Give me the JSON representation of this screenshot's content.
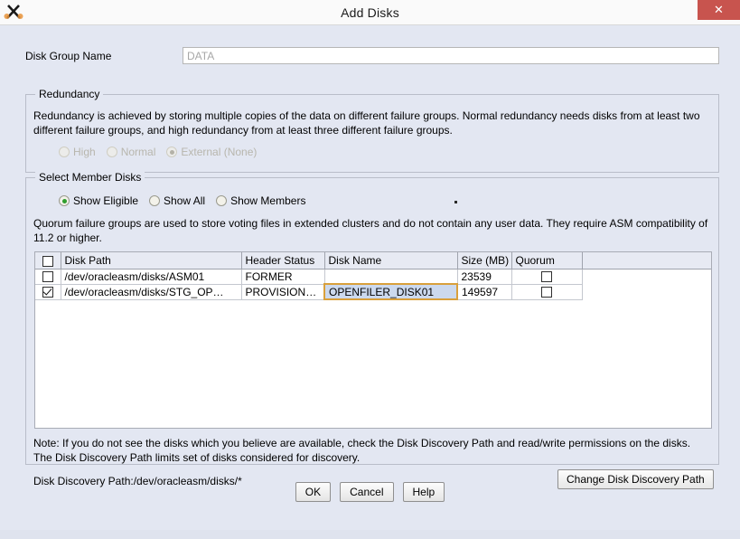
{
  "window": {
    "title": "Add Disks",
    "close_label": "✕",
    "app_icon": "x11-icon"
  },
  "disk_group": {
    "label": "Disk Group Name",
    "value": "DATA"
  },
  "redundancy": {
    "legend": "Redundancy",
    "description": "Redundancy is achieved by storing multiple copies of the data on different failure groups. Normal redundancy needs disks from at least two different failure groups, and high redundancy from at least three different failure groups.",
    "options": [
      {
        "label": "High",
        "selected": false,
        "disabled": true
      },
      {
        "label": "Normal",
        "selected": false,
        "disabled": true
      },
      {
        "label": "External (None)",
        "selected": true,
        "disabled": true
      }
    ]
  },
  "member_disks": {
    "legend": "Select Member Disks",
    "filter_options": [
      {
        "label": "Show Eligible",
        "selected": true
      },
      {
        "label": "Show All",
        "selected": false
      },
      {
        "label": "Show Members",
        "selected": false
      }
    ],
    "quorum_note": "Quorum failure groups are used to store voting files in extended clusters and do not contain any user data. They require ASM compatibility of 11.2 or higher.",
    "table": {
      "columns": [
        "",
        "Disk Path",
        "Header Status",
        "Disk Name",
        "Size (MB)",
        "Quorum"
      ],
      "rows": [
        {
          "selected": false,
          "disk_path": "/dev/oracleasm/disks/ASM01",
          "header_status": "FORMER",
          "disk_name": "",
          "size_mb": "23539",
          "quorum": false,
          "editing": false
        },
        {
          "selected": true,
          "disk_path": "/dev/oracleasm/disks/STG_OP…",
          "header_status": "PROVISIONED",
          "disk_name": "OPENFILER_DISK01",
          "size_mb": "149597",
          "quorum": false,
          "editing": true
        }
      ]
    },
    "note": "Note: If you do not see the disks which you believe are available, check the Disk Discovery Path and read/write permissions on the disks. The Disk Discovery Path limits set of disks considered for discovery.",
    "discovery_path": "Disk Discovery Path:/dev/oracleasm/disks/*",
    "change_path_label": "Change Disk Discovery Path"
  },
  "footer": {
    "ok_label": "OK",
    "cancel_label": "Cancel",
    "help_label": "Help"
  },
  "colors": {
    "dialog_background": "#e3e7f2",
    "close_button": "#c8544e",
    "selected_cell_border": "#d9a03c",
    "selected_cell_fill": "#ccd9ee",
    "radio_selected": "#2f9e2f"
  }
}
